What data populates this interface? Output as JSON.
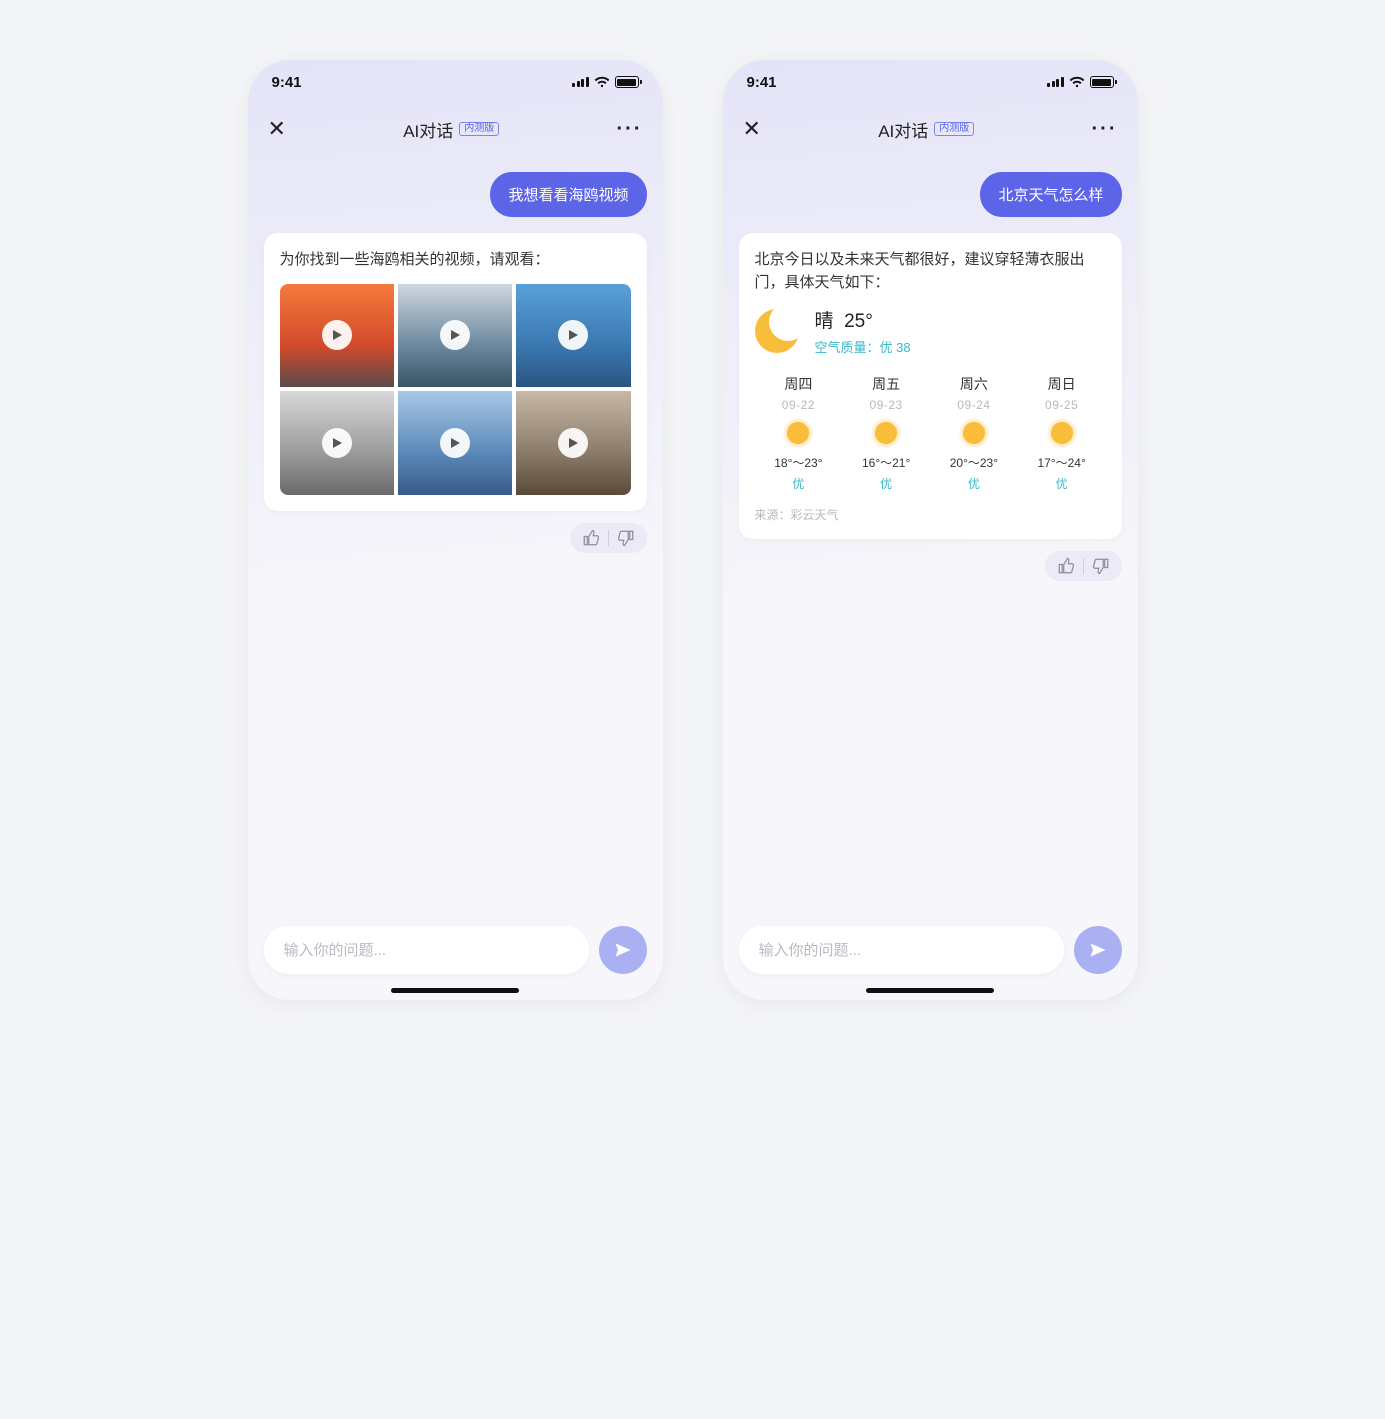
{
  "status": {
    "time": "9:41"
  },
  "nav": {
    "title": "AI对话",
    "beta": "内测版"
  },
  "input": {
    "placeholder": "输入你的问题..."
  },
  "left": {
    "user_msg": "我想看看海鸥视频",
    "ai_intro": "为你找到一些海鸥相关的视频，请观看："
  },
  "right": {
    "user_msg": "北京天气怎么样",
    "ai_intro": "北京今日以及未来天气都很好，建议穿轻薄衣服出门，具体天气如下：",
    "current": {
      "cond": "晴",
      "temp": "25°",
      "air_label": "空气质量：",
      "air_value": "优 38"
    },
    "forecast": [
      {
        "day": "周四",
        "date": "09-22",
        "range": "18°～23°",
        "aqi": "优"
      },
      {
        "day": "周五",
        "date": "09-23",
        "range": "16°～21°",
        "aqi": "优"
      },
      {
        "day": "周六",
        "date": "09-24",
        "range": "20°～23°",
        "aqi": "优"
      },
      {
        "day": "周日",
        "date": "09-25",
        "range": "17°～24°",
        "aqi": "优"
      }
    ],
    "source_label": "来源：",
    "source_value": "彩云天气"
  }
}
